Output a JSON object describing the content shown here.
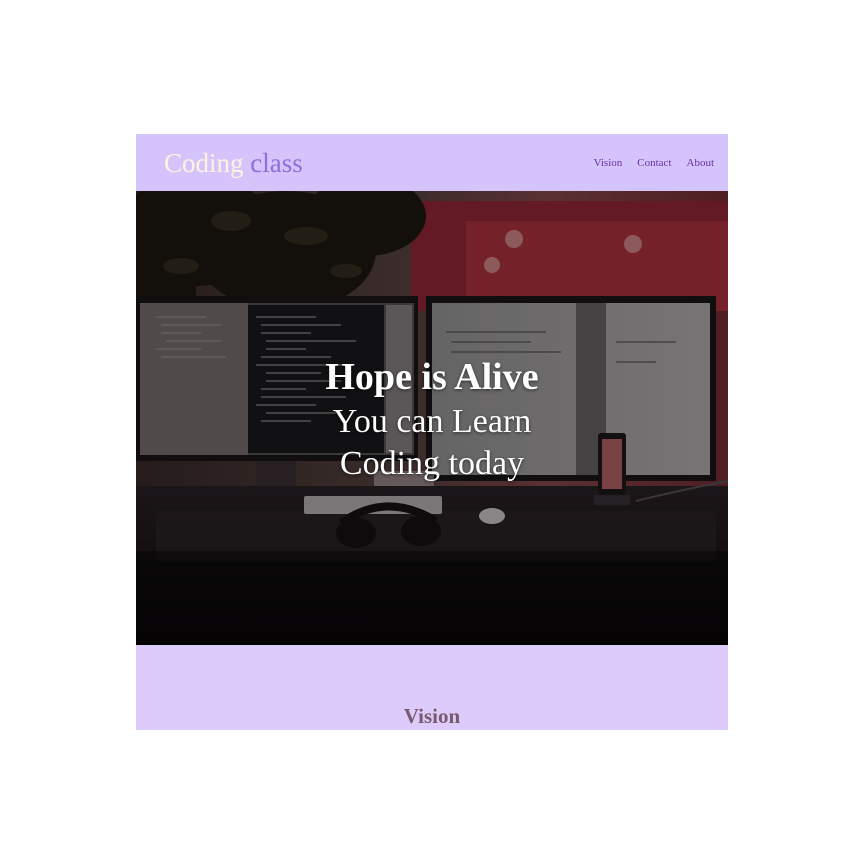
{
  "navbar": {
    "logo_word1": "Coding",
    "logo_word2": "class",
    "links": [
      {
        "label": "Vision"
      },
      {
        "label": "Contact"
      },
      {
        "label": "About"
      }
    ]
  },
  "hero": {
    "title": "Hope is Alive",
    "line1": "You can Learn",
    "line2": "Coding today",
    "background_image": "desk-with-two-monitors-photo"
  },
  "vision": {
    "heading": "Vision"
  },
  "colors": {
    "navbar_bg": "#d4c4fb",
    "logo_word1": "#fff3df",
    "logo_word2": "#8b72d9",
    "nav_link": "#6a2fa6",
    "section_bg": "#dccbfb",
    "vision_heading": "#7a5a6e"
  }
}
